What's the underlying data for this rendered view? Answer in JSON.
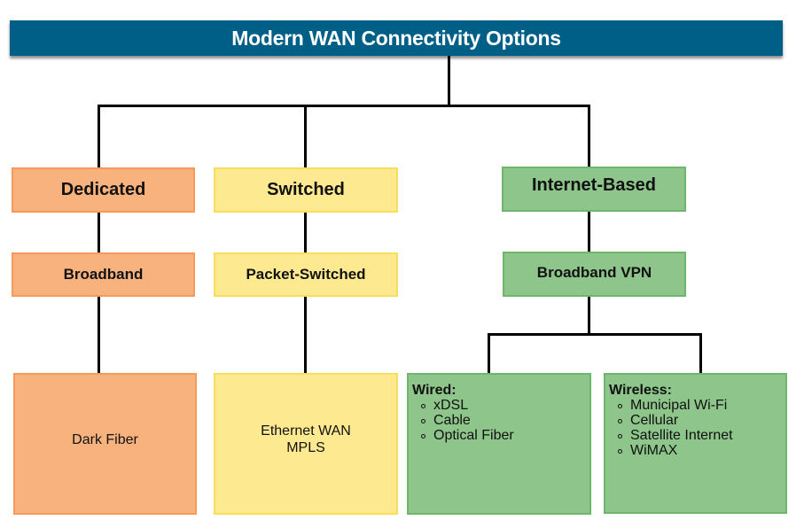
{
  "title": "Modern WAN Connectivity Options",
  "colors": {
    "title_bg": "#005f87",
    "dedicated": "#f7b27e",
    "switched": "#fde990",
    "internet": "#8dc58b"
  },
  "categories": [
    {
      "label": "Dedicated",
      "sub": "Broadband",
      "leaf": [
        "Dark Fiber"
      ]
    },
    {
      "label": "Switched",
      "sub": "Packet-Switched",
      "leaf": [
        "Ethernet WAN",
        "MPLS"
      ]
    },
    {
      "label": "Internet-Based",
      "sub": "Broadband VPN",
      "groups": [
        {
          "title": "Wired:",
          "items": [
            "xDSL",
            "Cable",
            "Optical Fiber"
          ]
        },
        {
          "title": "Wireless:",
          "items": [
            "Municipal Wi-Fi",
            "Cellular",
            "Satellite Internet",
            "WiMAX"
          ]
        }
      ]
    }
  ]
}
